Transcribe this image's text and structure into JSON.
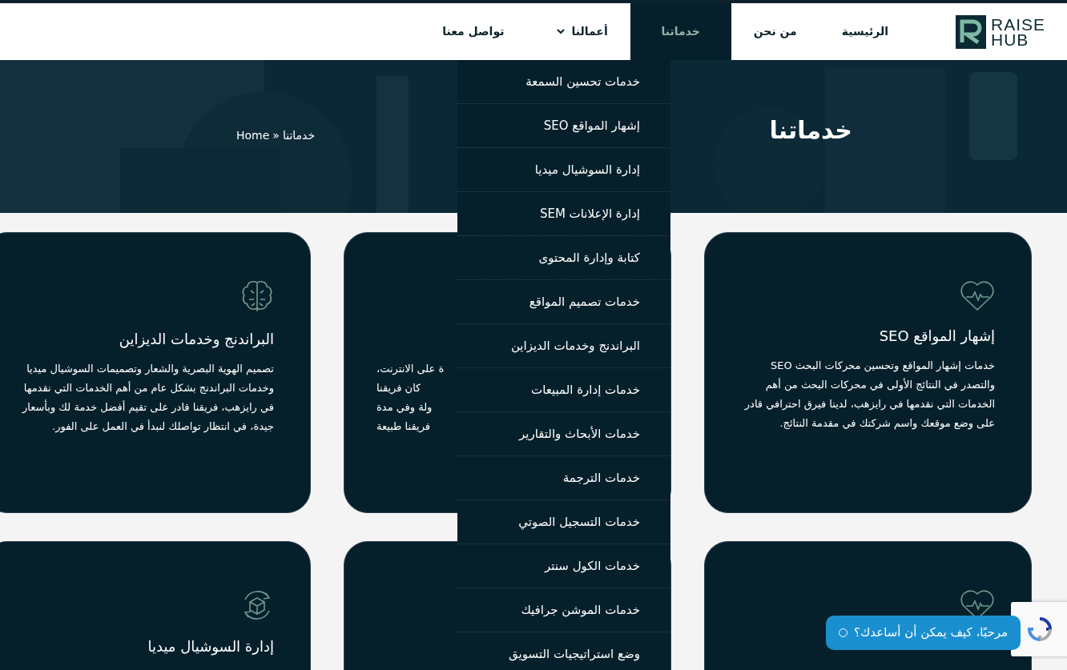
{
  "logo": {
    "line1": "RAISE",
    "line2": "HUB"
  },
  "nav": [
    {
      "label": "الرئيسية",
      "kind": "link",
      "selected": false
    },
    {
      "label": "من نحن",
      "kind": "link",
      "selected": false
    },
    {
      "label": "خدماتنا",
      "kind": "link",
      "selected": true
    },
    {
      "label": "أعمالنا",
      "kind": "dropdown",
      "selected": false
    },
    {
      "label": "تواصل معنا",
      "kind": "link",
      "selected": false
    }
  ],
  "services_menu": [
    "خدمات تحسين السمعة",
    "إشهار المواقع SEO",
    "إدارة السوشيال ميديا",
    "إدارة الإعلانات SEM",
    "كتابة وإدارة المحتوى",
    "خدمات تصميم المواقع",
    "البراندنج وخدمات الديزاين",
    "خدمات إدارة المبيعات",
    "خدمات الأبحاث والتقارير",
    "خدمات الترجمة",
    "خدمات التسجيل الصوتي",
    "خدمات الكول سنتر",
    "خدمات الموشن جرافيك",
    "وضع استراتيجيات التسويق"
  ],
  "hero": {
    "title": "خدماتنا",
    "breadcrumb": {
      "home": "Home",
      "separator": "»",
      "current": "خدماتنا"
    }
  },
  "cards": [
    {
      "title": "إشهار المواقع SEO",
      "text": "خدمات إشهار المواقع وتحسين محركات البحث SEO والتصدر في النتائج الأولى في محركات البحث من أهم الخدمات التي نقدمها في رايزهب، لدينا فيرق احترافي قادر على وضع موقعك واسم شركتك في مقدمة النتائج."
    },
    {
      "lines": [
        "ة على الانترنت،",
        "كان فريقنا",
        "ولة وفي مدة",
        "فريقنا طبيعة"
      ]
    },
    {
      "title": "البراندنج وخدمات الديزاين",
      "text": "تصميم الهوية البصرية والشعار وتصميمات السوشيال ميديا وخدمات البراندنج بشكل عام من أهم الخدمات التي نقدمها في رايزهب، فريقنا قادر على تقيم أفضل خدمة لك وبأسعار جيدة، في انتظار تواصلك لنبدأ في العمل على الفور."
    },
    {
      "kind": "icon_only"
    },
    {
      "kind": "empty"
    },
    {
      "title": "إدارة السوشيال ميديا"
    }
  ],
  "chat": {
    "message": "مرحبًا، كيف يمكن أن أساعدك؟"
  }
}
